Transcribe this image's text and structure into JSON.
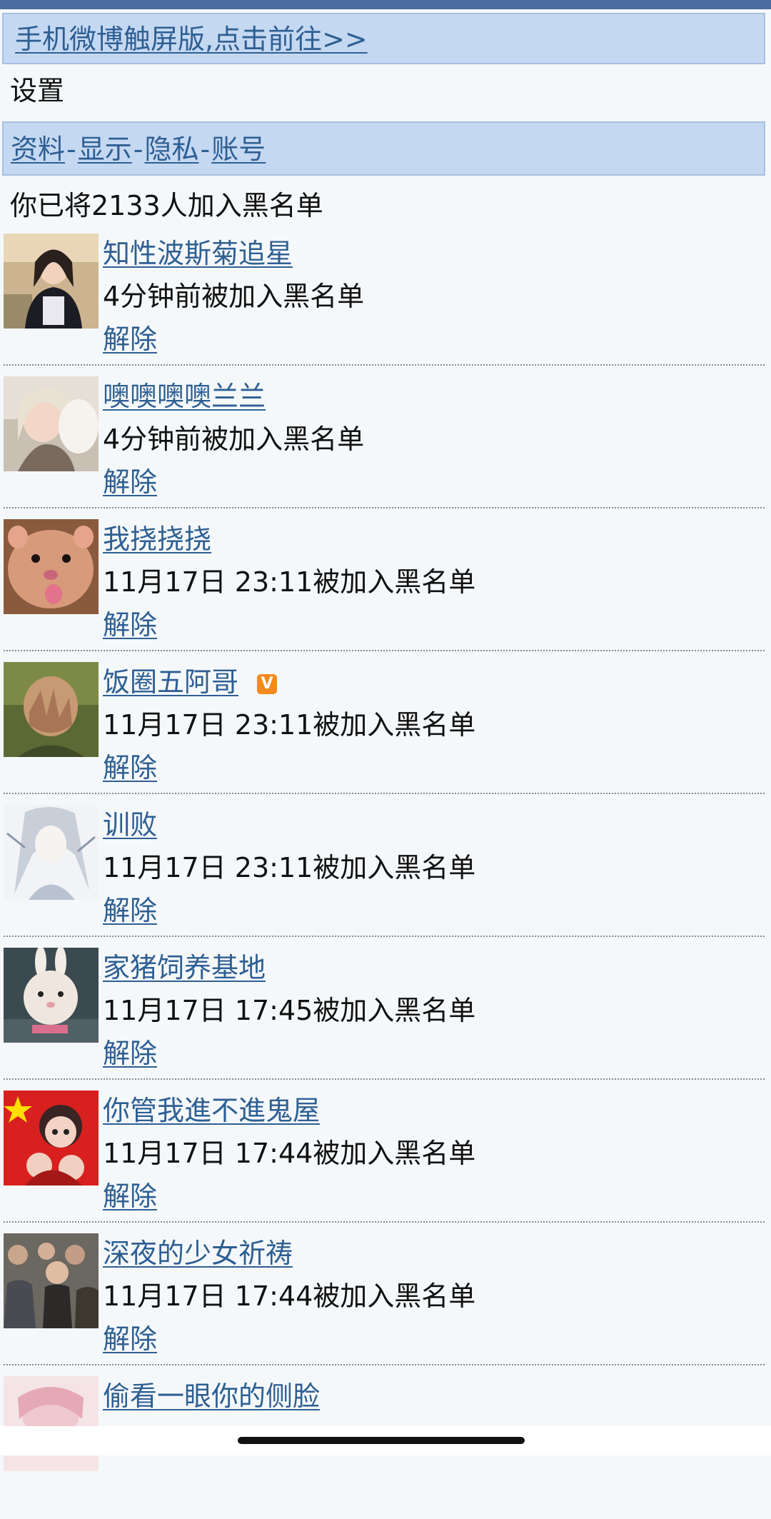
{
  "banner": {
    "touch_link": "手机微博触屏版,点击前往>>"
  },
  "settings": {
    "title": "设置",
    "nav": {
      "profile": "资料",
      "display": "显示",
      "privacy": "隐私",
      "account": "账号",
      "separator": "-"
    }
  },
  "blacklist": {
    "summary": "你已将2133人加入黑名单",
    "remove_label": "解除",
    "entries": [
      {
        "name": "知性波斯菊追星",
        "time": "4分钟前被加入黑名单"
      },
      {
        "name": "噢噢噢噢兰兰",
        "time": "4分钟前被加入黑名单"
      },
      {
        "name": "我挠挠挠",
        "time": "11月17日 23:11被加入黑名单"
      },
      {
        "name": "饭圈五阿哥",
        "time": "11月17日 23:11被加入黑名单",
        "badge": "V"
      },
      {
        "name": "训败",
        "time": "11月17日 23:11被加入黑名单"
      },
      {
        "name": "家猪饲养基地",
        "time": "11月17日 17:45被加入黑名单"
      },
      {
        "name": "你管我進不進鬼屋",
        "time": "11月17日 17:44被加入黑名单"
      },
      {
        "name": "深夜的少女祈祷",
        "time": "11月17日 17:44被加入黑名单"
      },
      {
        "name": "偷看一眼你的侧脸",
        "time": ""
      }
    ]
  },
  "colors": {
    "link": "#2e5f93",
    "banner_bg": "#c5d8f2",
    "top_bar": "#4a6b9d",
    "vip_badge": "#f38a1d"
  }
}
